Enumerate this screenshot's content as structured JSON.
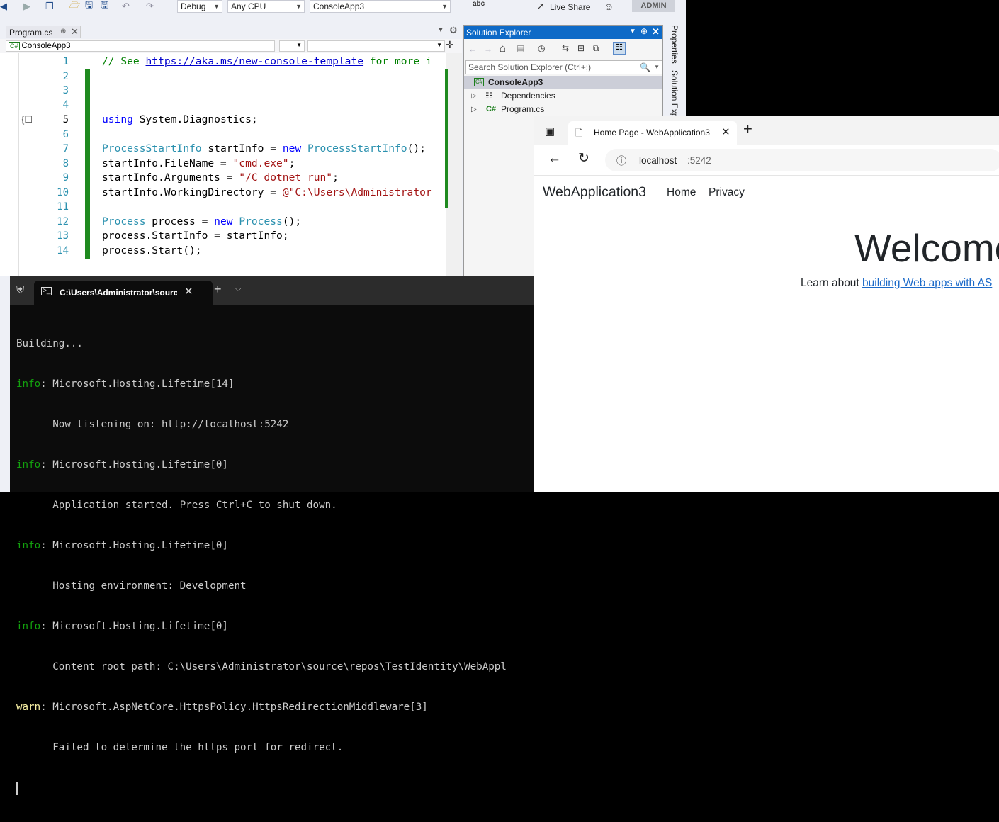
{
  "vs": {
    "toolbar": {
      "config": "Debug",
      "platform": "Any CPU",
      "startup": "ConsoleApp3",
      "live_share": "Live Share",
      "admin": "ADMIN",
      "spell": "abc"
    },
    "doc_tab": {
      "label": "Program.cs"
    },
    "nav_project": "ConsoleApp3",
    "code_lines": [
      {
        "n": "1"
      },
      {
        "n": "2"
      },
      {
        "n": "3"
      },
      {
        "n": "4"
      },
      {
        "n": "5"
      },
      {
        "n": "6"
      },
      {
        "n": "7"
      },
      {
        "n": "8"
      },
      {
        "n": "9"
      },
      {
        "n": "10"
      },
      {
        "n": "11"
      },
      {
        "n": "12"
      },
      {
        "n": "13"
      },
      {
        "n": "14"
      }
    ],
    "code": {
      "l1_comment": "// See ",
      "l1_link": "https://aka.ms/new-console-template",
      "l1_rest": " for more i",
      "l5_kw": "using",
      "l5_rest": " System.Diagnostics;",
      "l7_type": "ProcessStartInfo",
      "l7_var": " startInfo = ",
      "l7_new": "new",
      "l7_type2": " ProcessStartInfo",
      "l7_end": "();",
      "l8_a": "startInfo.FileName = ",
      "l8_s": "\"cmd.exe\"",
      "l8_e": ";",
      "l9_a": "startInfo.Arguments = ",
      "l9_s": "\"/C dotnet run\"",
      "l9_e": ";",
      "l10_a": "startInfo.WorkingDirectory = ",
      "l10_s": "@\"C:\\Users\\Administrator",
      "l12_type": "Process",
      "l12_var": " process = ",
      "l12_new": "new",
      "l12_type2": " Process",
      "l12_end": "();",
      "l13": "process.StartInfo = startInfo;",
      "l14": "process.Start();"
    },
    "solution_explorer": {
      "title": "Solution Explorer",
      "search_placeholder": "Search Solution Explorer (Ctrl+;)",
      "items": [
        {
          "label": "ConsoleApp3",
          "icon": "csharp-project-icon"
        },
        {
          "label": "Dependencies",
          "icon": "dependencies-icon"
        },
        {
          "label": "Program.cs",
          "icon": "csharp-file-icon"
        }
      ]
    },
    "side_tabs": {
      "properties": "Properties",
      "solution_explorer": "Solution Exp"
    }
  },
  "terminal": {
    "tab_title": "C:\\Users\\Administrator\\source",
    "lines": [
      {
        "prefix": "",
        "text": "Building..."
      },
      {
        "prefix": "info",
        "text": ": Microsoft.Hosting.Lifetime[14]"
      },
      {
        "prefix": "",
        "text": "      Now listening on: http://localhost:5242"
      },
      {
        "prefix": "info",
        "text": ": Microsoft.Hosting.Lifetime[0]"
      },
      {
        "prefix": "",
        "text": "      Application started. Press Ctrl+C to shut down."
      },
      {
        "prefix": "info",
        "text": ": Microsoft.Hosting.Lifetime[0]"
      },
      {
        "prefix": "",
        "text": "      Hosting environment: Development"
      },
      {
        "prefix": "info",
        "text": ": Microsoft.Hosting.Lifetime[0]"
      },
      {
        "prefix": "",
        "text": "      Content root path: C:\\Users\\Administrator\\source\\repos\\TestIdentity\\WebAppl"
      },
      {
        "prefix": "warn",
        "text": ": Microsoft.AspNetCore.HttpsPolicy.HttpsRedirectionMiddleware[3]"
      },
      {
        "prefix": "",
        "text": "      Failed to determine the https port for redirect."
      }
    ]
  },
  "browser": {
    "tab_title": "Home Page - WebApplication3",
    "url_host": "localhost",
    "url_port": ":5242",
    "brand": "WebApplication3",
    "nav": [
      "Home",
      "Privacy"
    ],
    "heading": "Welcome",
    "learn_text": "Learn about ",
    "learn_link": "building Web apps with AS"
  },
  "colors": {
    "vs_accent": "#0e6ac7",
    "green_bar": "#1f8a1f",
    "terminal_info": "#13a10e",
    "terminal_warn": "#f9f1a5",
    "link": "#1b6ac9"
  }
}
